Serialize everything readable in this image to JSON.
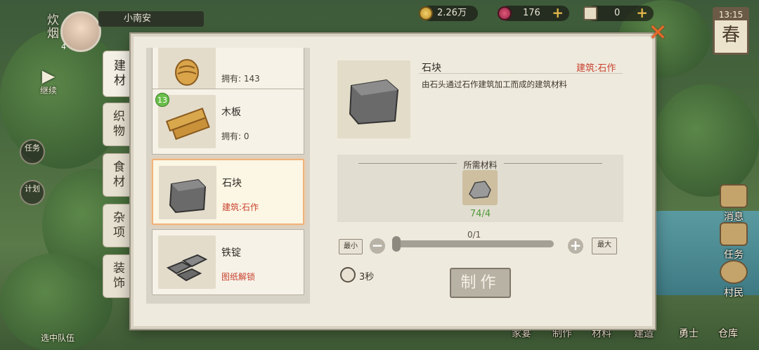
{
  "hud": {
    "btn_smoke": "炊烟",
    "btn_continue": "继续",
    "btn_task": "任务",
    "btn_plan": "计划",
    "btn_team": "选中队伍",
    "player_name": "小南安",
    "player_level": "4",
    "money": "2.26万",
    "gems": "176",
    "tickets": "0",
    "time": "13:15",
    "season": "春"
  },
  "right_hud": [
    "消息",
    "任务",
    "村民"
  ],
  "bottom_bar": [
    "家宴",
    "制作",
    "材料",
    "建造",
    "勇士",
    "仓库"
  ],
  "tabs": [
    "建材",
    "织物",
    "食材",
    "杂项",
    "装饰"
  ],
  "items": [
    {
      "name": "",
      "sub": "拥有: 143"
    },
    {
      "name": "木板",
      "sub": "拥有: 0",
      "badge": "13"
    },
    {
      "name": "石块",
      "sub": "建筑:石作"
    },
    {
      "name": "铁锭",
      "sub": "图纸解锁"
    }
  ],
  "detail": {
    "name": "石块",
    "category": "建筑:石作",
    "description": "由石头通过石作建筑加工而成的建筑材料",
    "req_title": "所需材料",
    "req_have": "74",
    "req_sep": "/",
    "req_need": "4",
    "slider_count": "0/1",
    "min_label": "最小",
    "max_label": "最大",
    "duration": "3秒",
    "craft_label": "制作"
  },
  "colors": {
    "accent_red": "#c8432f",
    "ok_green": "#4f9a3a",
    "close_orange": "#e86a2a"
  }
}
